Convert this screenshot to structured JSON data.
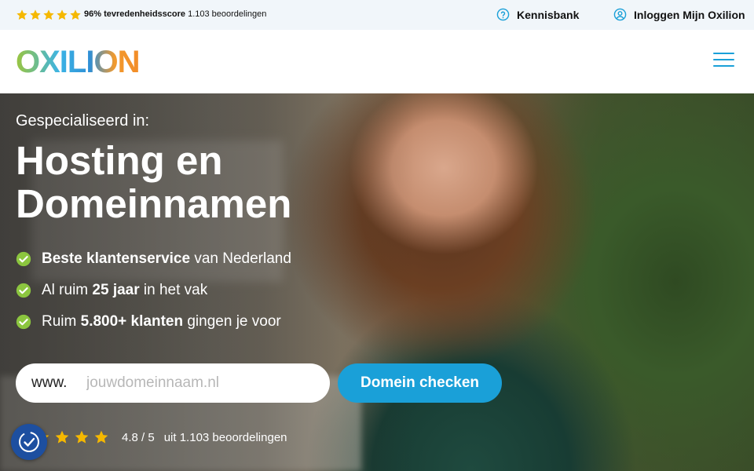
{
  "topbar": {
    "score_bold": "96% tevredenheidsscore",
    "score_rest": " 1.103 beoordelingen",
    "kennisbank_label": "Kennisbank",
    "login_label": "Inloggen Mijn Oxilion"
  },
  "header": {
    "logo_text": "OXILION",
    "menu_icon": "hamburger-menu-icon"
  },
  "hero": {
    "subtitle": "Gespecialiseerd in:",
    "title_line1": "Hosting en",
    "title_line2": "Domeinnamen",
    "usps": [
      {
        "bold": "Beste klantenservice",
        "after": " van Nederland",
        "before": ""
      },
      {
        "before": "Al ruim ",
        "bold": "25 jaar",
        "after": " in het vak"
      },
      {
        "before": "Ruim ",
        "bold": "5.800+ klanten",
        "after": " gingen je voor"
      }
    ],
    "domain_prefix": "www.",
    "domain_placeholder": "jouwdomeinnaam.nl",
    "check_button_label": "Domein checken",
    "rating_value": "4.8 / 5",
    "rating_count": "uit 1.103 beoordelingen"
  },
  "colors": {
    "accent": "#1aa0d8",
    "star": "#f5b800",
    "check": "#8cc63f",
    "cookie": "#1d4fa0"
  }
}
